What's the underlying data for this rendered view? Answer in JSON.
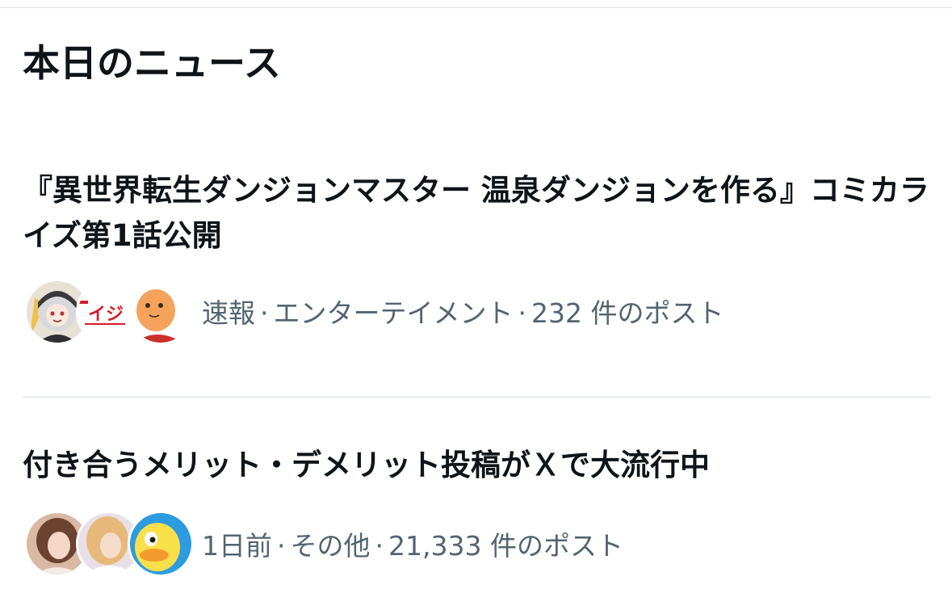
{
  "section": {
    "title": "本日のニュース"
  },
  "news": [
    {
      "headline": "『異世界転生ダンジョンマスター 温泉ダンジョンを作る』コミカライズ第1話公開",
      "time": "速報",
      "category": "エンターテイメント",
      "posts": "232 件のポスト",
      "separator": "·"
    },
    {
      "headline": "付き合うメリット・デメリット投稿がＸで大流行中",
      "time": "1日前",
      "category": "その他",
      "posts": "21,333 件のポスト",
      "separator": "·"
    }
  ],
  "avatar_text": {
    "brand_logo": "イジ"
  },
  "colors": {
    "text_primary": "#0f1419",
    "text_secondary": "#536471",
    "divider": "#cfd9de",
    "background": "#ffffff"
  }
}
